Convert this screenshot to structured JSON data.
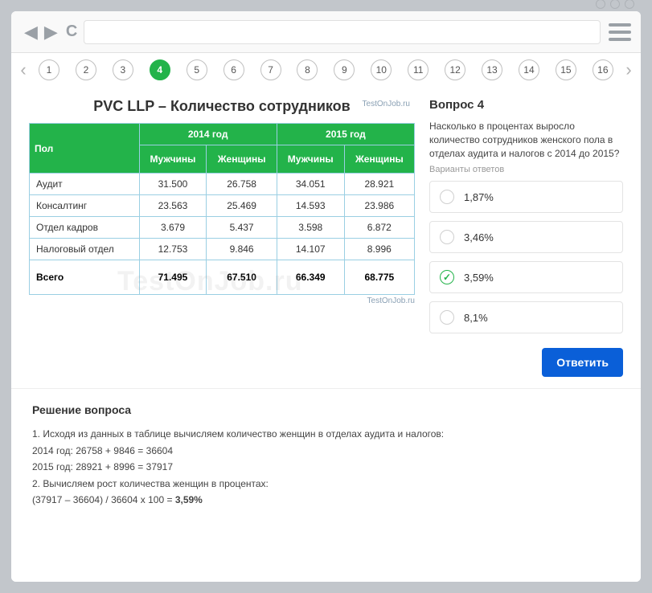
{
  "pager": {
    "items": [
      "1",
      "2",
      "3",
      "4",
      "5",
      "6",
      "7",
      "8",
      "9",
      "10",
      "11",
      "12",
      "13",
      "14",
      "15",
      "16"
    ],
    "active": "4"
  },
  "table": {
    "title": "PVC LLP – Количество сотрудников",
    "watermark_top": "TestOnJob.ru",
    "watermark_bottom": "TestOnJob.ru",
    "watermark_bg": "TestOnJob.ru",
    "year1": "2014 год",
    "year2": "2015 год",
    "col0": "Пол",
    "col1": "Мужчины",
    "col2": "Женщины",
    "col3": "Мужчины",
    "col4": "Женщины",
    "rows": {
      "r1": {
        "label": "Аудит",
        "v1": "31.500",
        "v2": "26.758",
        "v3": "34.051",
        "v4": "28.921"
      },
      "r2": {
        "label": "Консалтинг",
        "v1": "23.563",
        "v2": "25.469",
        "v3": "14.593",
        "v4": "23.986"
      },
      "r3": {
        "label": "Отдел кадров",
        "v1": "3.679",
        "v2": "5.437",
        "v3": "3.598",
        "v4": "6.872"
      },
      "r4": {
        "label": "Налоговый отдел",
        "v1": "12.753",
        "v2": "9.846",
        "v3": "14.107",
        "v4": "8.996"
      }
    },
    "total": {
      "label": "Всего",
      "v1": "71.495",
      "v2": "67.510",
      "v3": "66.349",
      "v4": "68.775"
    }
  },
  "question": {
    "title": "Вопрос 4",
    "text": "Насколько в процентах выросло количество сотрудников женского пола в отделах аудита и налогов с 2014 до 2015?",
    "variants_label": "Варианты ответов",
    "options": {
      "o1": "1,87%",
      "o2": "3,46%",
      "o3": "3,59%",
      "o4": "8,1%"
    },
    "selected": "o3",
    "submit": "Ответить"
  },
  "solution": {
    "title": "Решение вопроса",
    "l1": "1. Исходя из данных в таблице вычисляем количество женщин в отделах аудита и налогов:",
    "l2": "2014 год: 26758 + 9846 = 36604",
    "l3": "2015 год: 28921 + 8996 = 37917",
    "l4": "2. Вычисляем рост количества женщин в процентах:",
    "l5a": "(37917 – 36604) / 36604 x 100 = ",
    "l5b": "3,59%"
  }
}
